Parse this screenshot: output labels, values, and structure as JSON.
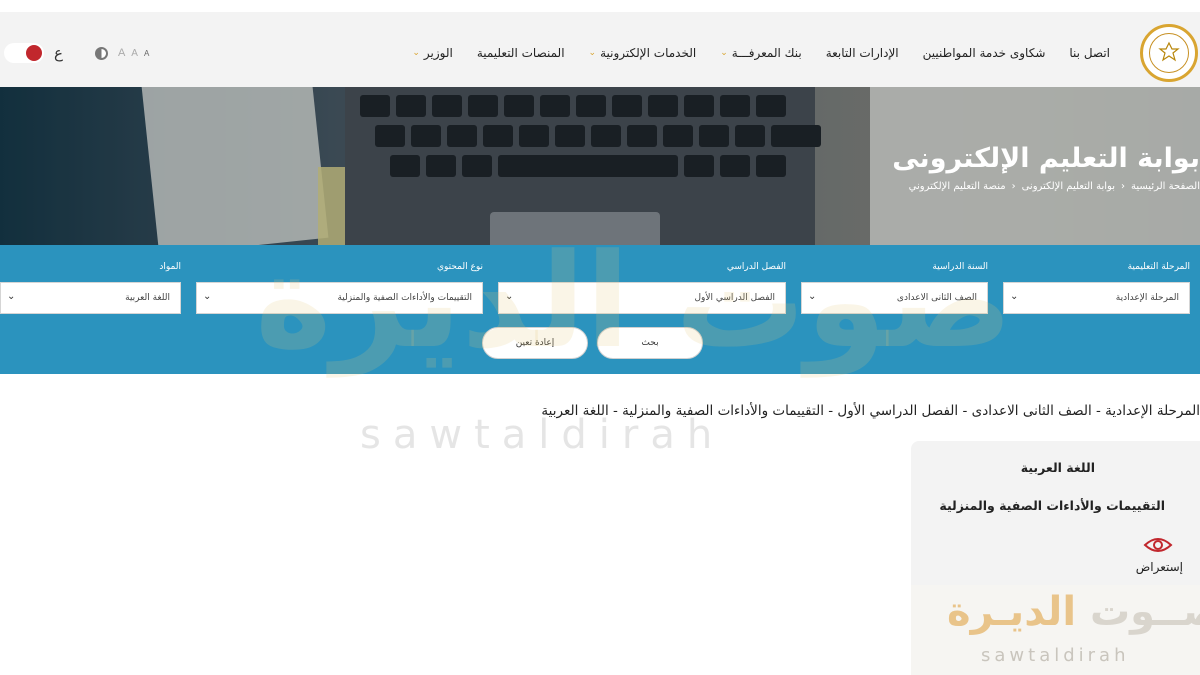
{
  "header": {
    "nav": [
      {
        "label": "الوزير",
        "has_dropdown": true
      },
      {
        "label": "المنصات التعليمية",
        "has_dropdown": false
      },
      {
        "label": "الخدمات الإلكترونية",
        "has_dropdown": true
      },
      {
        "label": "بنك المعرفـــة",
        "has_dropdown": true
      },
      {
        "label": "الإدارات التابعة",
        "has_dropdown": false
      },
      {
        "label": "شكاوى خدمة المواطنيين",
        "has_dropdown": false
      },
      {
        "label": "اتصل بنا",
        "has_dropdown": false
      }
    ],
    "lang_label": "ع",
    "font_sizes": [
      "A",
      "A",
      "A"
    ],
    "icons": {
      "contrast": "contrast-icon",
      "logo": "ministry-seal-icon",
      "dropdown": "chevron-down-icon"
    }
  },
  "hero": {
    "title": "بوابة التعليم الإلكترونى",
    "breadcrumb": [
      "الصفحة الرئيسية",
      "بوابة التعليم الإلكترونى",
      "منصة التعليم الإلكتروني"
    ]
  },
  "filters": [
    {
      "label": "المرحلة التعليمية",
      "value": "المرحلة الإعدادية"
    },
    {
      "label": "السنة الدراسية",
      "value": "الصف الثانى الاعدادى"
    },
    {
      "label": "الفصل الدراسي",
      "value": "الفصل الدراسي الأول"
    },
    {
      "label": "نوع المحتوي",
      "value": "التقييمات والأداءات الصفية والمنزلية"
    },
    {
      "label": "المواد",
      "value": "اللغة العربية"
    }
  ],
  "buttons": {
    "search": "بحث",
    "reset": "إعادة تعين"
  },
  "result_summary": "المرحلة الإعدادية - الصف الثانى الاعدادى - الفصل الدراسي الأول - التقييمات والأداءات الصفية والمنزلية - اللغة العربية",
  "card": {
    "subject": "اللغة العربية",
    "content_type": "التقييمات والأداءات الصفية والمنزلية",
    "view_label": "إستعراض",
    "icon": "eye-icon"
  },
  "watermark": {
    "arabic_a": "صــوت",
    "arabic_b": "الديـرة",
    "latin": "sawtaldirah"
  },
  "colors": {
    "filter_band": "#2b93be",
    "toggle_knob": "#c1272d",
    "accent": "#d9a531",
    "corner": "#f2a900"
  }
}
